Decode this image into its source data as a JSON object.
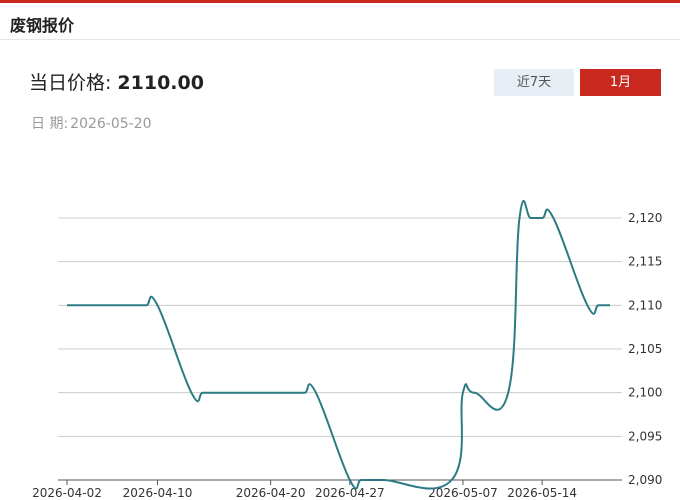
{
  "header": {
    "title": "废钢报价"
  },
  "price": {
    "label": "当日价格:",
    "value": "2110.00"
  },
  "date": {
    "label": "日 期:",
    "value": "2026-05-20"
  },
  "range_buttons": [
    {
      "label": "近7天",
      "active": false
    },
    {
      "label": "1月",
      "active": true
    }
  ],
  "colors": {
    "accent": "#c8281e",
    "line": "#2c7b84",
    "grid": "#cccccc"
  },
  "chart_data": {
    "type": "line",
    "title": "",
    "xlabel": "",
    "ylabel": "",
    "ylim": [
      2090,
      2120
    ],
    "grid": true,
    "y_ticks": [
      "2,090",
      "2,095",
      "2,100",
      "2,105",
      "2,110",
      "2,115",
      "2,120"
    ],
    "x_tick_labels": [
      "2026-04-02",
      "2026-04-10",
      "2026-04-20",
      "2026-04-27",
      "2026-05-07",
      "2026-05-14"
    ],
    "x": [
      "2026-04-02",
      "2026-04-03",
      "2026-04-07",
      "2026-04-08",
      "2026-04-09",
      "2026-04-10",
      "2026-04-13",
      "2026-04-14",
      "2026-04-15",
      "2026-04-16",
      "2026-04-17",
      "2026-04-20",
      "2026-04-21",
      "2026-04-22",
      "2026-04-23",
      "2026-04-24",
      "2026-04-27",
      "2026-04-28",
      "2026-04-29",
      "2026-04-30",
      "2026-05-06",
      "2026-05-07",
      "2026-05-08",
      "2026-05-11",
      "2026-05-12",
      "2026-05-13",
      "2026-05-14",
      "2026-05-15",
      "2026-05-18",
      "2026-05-19",
      "2026-05-20"
    ],
    "series": [
      {
        "values": [
          2110,
          2110,
          2110,
          2110,
          2110,
          2110,
          2100,
          2100,
          2100,
          2100,
          2100,
          2100,
          2100,
          2100,
          2100,
          2100,
          2090,
          2090,
          2090,
          2090,
          2090,
          2100,
          2100,
          2100,
          2120,
          2120,
          2120,
          2120,
          2110,
          2110,
          2110
        ]
      }
    ]
  }
}
